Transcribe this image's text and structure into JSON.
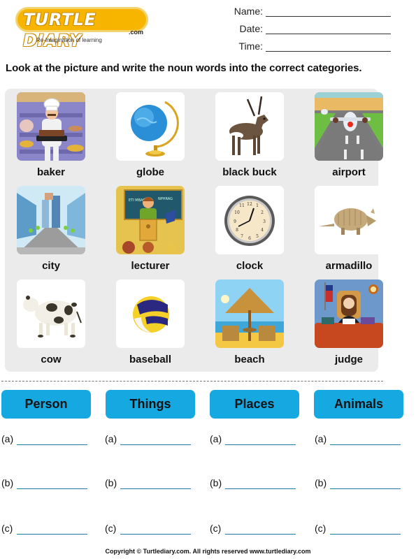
{
  "logo": {
    "wordmark": "TURTLE DIARY",
    "domain_suffix": ".com",
    "tagline": "Re-Imagination of learning"
  },
  "meta_fields": [
    {
      "label": "Name:",
      "value": ""
    },
    {
      "label": "Date:",
      "value": ""
    },
    {
      "label": "Time:",
      "value": ""
    }
  ],
  "instruction": "Look at the picture and write the noun words into the correct categories.",
  "pictures": [
    {
      "word": "baker",
      "icon": "baker-picture"
    },
    {
      "word": "globe",
      "icon": "globe-picture"
    },
    {
      "word": "black buck",
      "icon": "blackbuck-picture"
    },
    {
      "word": "airport",
      "icon": "airport-picture"
    },
    {
      "word": "city",
      "icon": "city-picture"
    },
    {
      "word": "lecturer",
      "icon": "lecturer-picture"
    },
    {
      "word": "clock",
      "icon": "clock-picture"
    },
    {
      "word": "armadillo",
      "icon": "armadillo-picture"
    },
    {
      "word": "cow",
      "icon": "cow-picture"
    },
    {
      "word": "baseball",
      "icon": "ball-picture"
    },
    {
      "word": "beach",
      "icon": "beach-picture"
    },
    {
      "word": "judge",
      "icon": "judge-picture"
    }
  ],
  "categories": [
    {
      "title": "Person",
      "answers": [
        {
          "marker": "(a)",
          "value": ""
        },
        {
          "marker": "(b)",
          "value": ""
        },
        {
          "marker": "(c)",
          "value": ""
        }
      ]
    },
    {
      "title": "Things",
      "answers": [
        {
          "marker": "(a)",
          "value": ""
        },
        {
          "marker": "(b)",
          "value": ""
        },
        {
          "marker": "(c)",
          "value": ""
        }
      ]
    },
    {
      "title": "Places",
      "answers": [
        {
          "marker": "(a)",
          "value": ""
        },
        {
          "marker": "(b)",
          "value": ""
        },
        {
          "marker": "(c)",
          "value": ""
        }
      ]
    },
    {
      "title": "Animals",
      "answers": [
        {
          "marker": "(a)",
          "value": ""
        },
        {
          "marker": "(b)",
          "value": ""
        },
        {
          "marker": "(c)",
          "value": ""
        }
      ]
    }
  ],
  "colors": {
    "category_header": "#16a9e1",
    "logo_yellow": "#f7b500",
    "answer_line": "#1d7aa8",
    "panel_bg": "#ebebeb"
  },
  "footer": "Copyright © Turtlediary.com. All rights reserved  www.turtlediary.com"
}
